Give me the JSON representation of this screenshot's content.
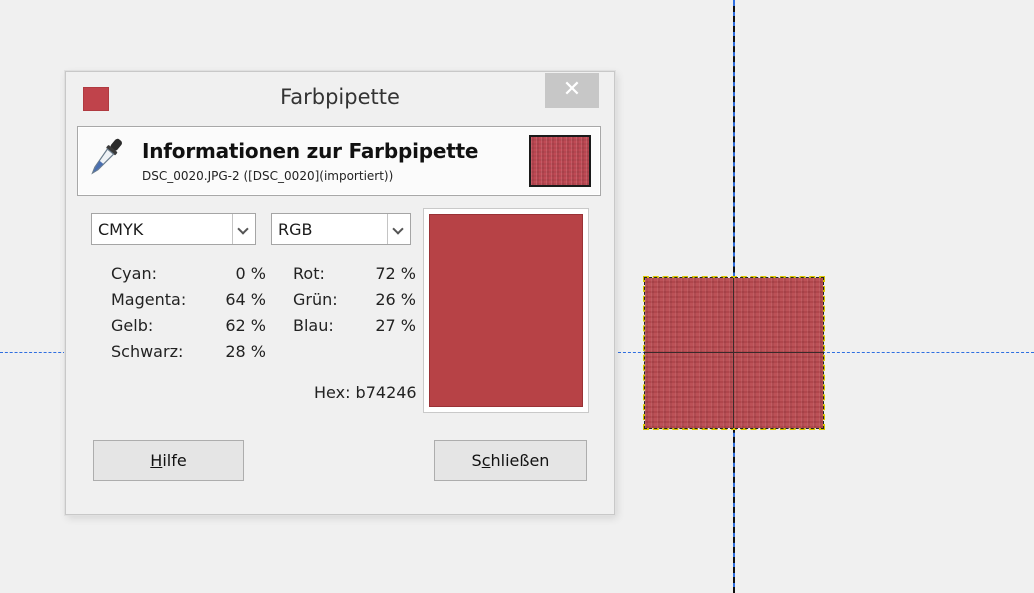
{
  "dialog": {
    "title": "Farbpipette",
    "close_glyph": "✕",
    "colors": {
      "sample": "#b74246",
      "close_button_bg": "#c7c7c7"
    }
  },
  "header": {
    "title": "Informationen zur Farbpipette",
    "subtitle": "DSC_0020.JPG-2 ([DSC_0020](importiert))",
    "icon": "color-picker-icon"
  },
  "left_panel": {
    "mode": "CMYK",
    "rows": [
      {
        "label": "Cyan:",
        "value": "0 %"
      },
      {
        "label": "Magenta:",
        "value": "64 %"
      },
      {
        "label": "Gelb:",
        "value": "62 %"
      },
      {
        "label": "Schwarz:",
        "value": "28 %"
      }
    ]
  },
  "right_panel": {
    "mode": "RGB",
    "rows": [
      {
        "label": "Rot:",
        "value": "72 %"
      },
      {
        "label": "Grün:",
        "value": "26 %"
      },
      {
        "label": "Blau:",
        "value": "27 %"
      }
    ],
    "hex_label": "Hex:",
    "hex_value": "b74246"
  },
  "buttons": {
    "help_mnemonic": "H",
    "help_rest": "ilfe",
    "close_pre": "S",
    "close_mnemonic": "c",
    "close_rest": "hließen"
  }
}
